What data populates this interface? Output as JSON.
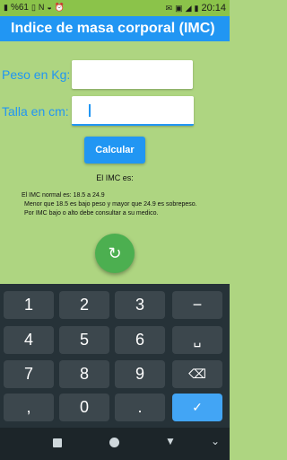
{
  "status_bar": {
    "battery_text": "%61",
    "time": "20:14",
    "icons_left": [
      "battery-icon",
      "vibrate-icon",
      "nfc-icon",
      "wifi-icon",
      "alarm-icon"
    ],
    "icons_right": [
      "mail-icon",
      "lock-icon",
      "signal-icon",
      "battery-icon"
    ]
  },
  "app_bar": {
    "title": "Indice de masa corporal (IMC)"
  },
  "form": {
    "weight_label": "Peso en Kg:",
    "weight_value": "",
    "height_label": "Talla en cm:",
    "height_value": "",
    "calculate_label": "Calcular"
  },
  "result": {
    "label": "El IMC es:"
  },
  "info": {
    "line1": "El IMC normal es: 18.5 a 24.9",
    "line2": "Menor que 18.5 es bajo peso y mayor que 24.9 es sobrepeso.",
    "line3": "Por IMC bajo o alto debe consultar a su medico."
  },
  "fab": {
    "icon": "refresh-icon"
  },
  "keyboard": {
    "rows": [
      [
        "1",
        "2",
        "3",
        "−"
      ],
      [
        "4",
        "5",
        "6",
        "␣"
      ],
      [
        "7",
        "8",
        "9",
        "⌫"
      ],
      [
        ",",
        "0",
        ".",
        "✓"
      ]
    ]
  },
  "colors": {
    "background": "#aed581",
    "status_bar": "#8bc34a",
    "app_bar": "#2196f3",
    "accent": "#2196f3",
    "fab": "#4caf50",
    "keyboard": "#263238",
    "enter_key": "#42a5f5"
  }
}
